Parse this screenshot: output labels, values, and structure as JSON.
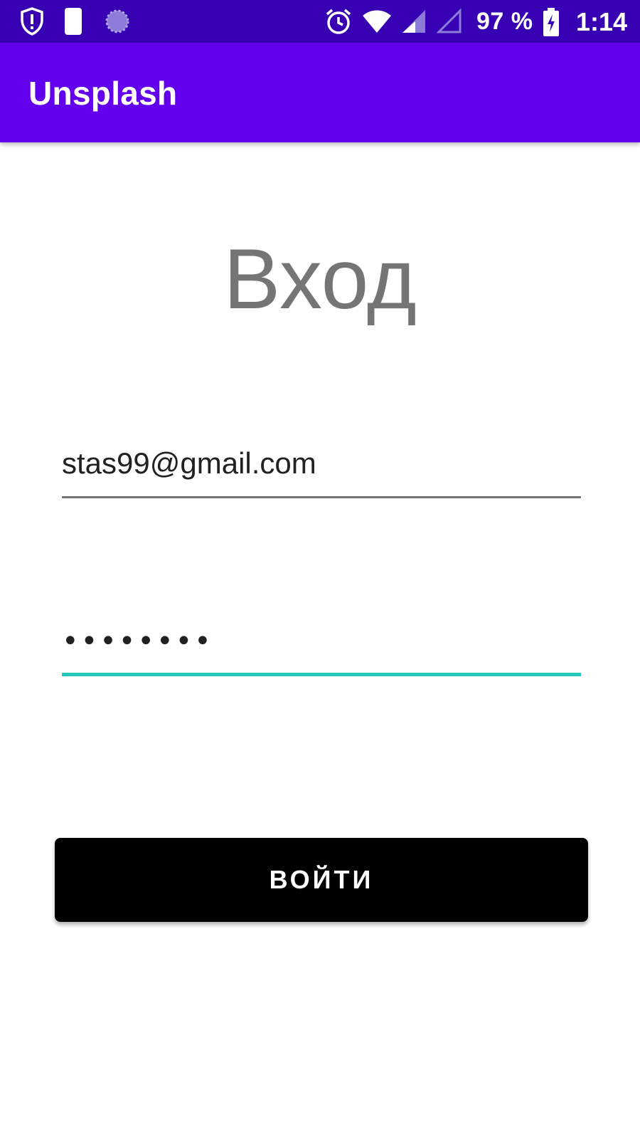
{
  "status_bar": {
    "icons": {
      "left": [
        "shield-alert-icon",
        "do-not-disturb-icon",
        "sync-icon"
      ],
      "right": [
        "alarm-icon",
        "wifi-icon",
        "cell-signal-icon",
        "cell-signal-empty-icon",
        "battery-charging-icon"
      ]
    },
    "battery": "97 %",
    "time": "1:14"
  },
  "app_bar": {
    "title": "Unsplash"
  },
  "login": {
    "heading": "Вход",
    "email_value": "stas99@gmail.com",
    "password_value": "12345678",
    "button_label": "ВОЙТИ"
  },
  "colors": {
    "status_bar": "#3700b3",
    "app_bar": "#6200ee",
    "heading": "#757575",
    "focused_underline": "#26c6c0",
    "button": "#000000"
  }
}
